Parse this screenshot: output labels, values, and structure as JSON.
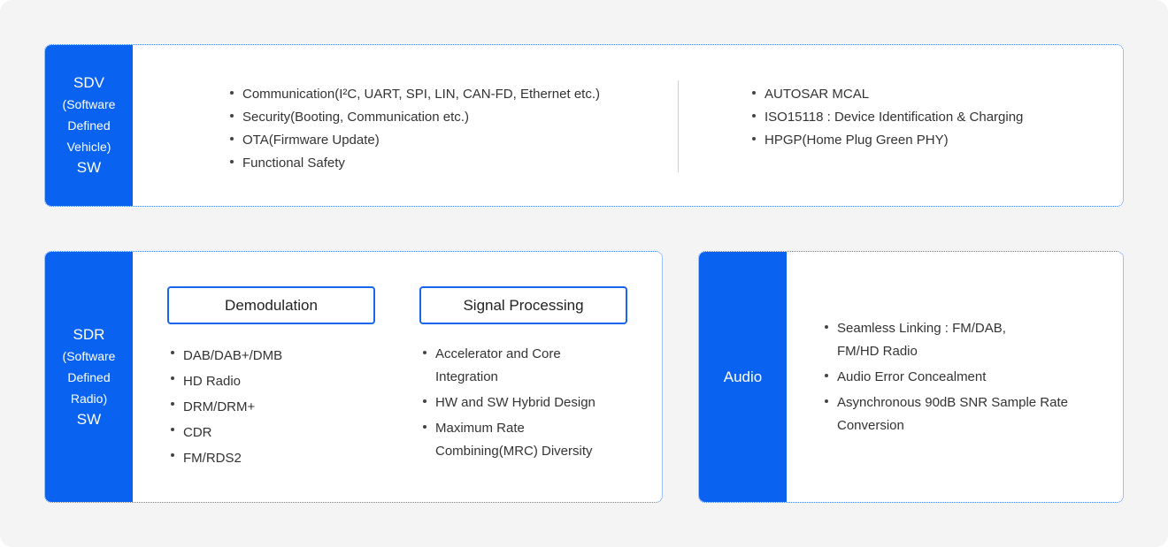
{
  "sdv": {
    "side": {
      "line1": "SDV",
      "line2": "(Software",
      "line3": "Defined",
      "line4": "Vehicle)",
      "line5": "SW"
    },
    "left_items": [
      "Communication(I²C, UART, SPI, LIN, CAN-FD, Ethernet etc.)",
      "Security(Booting, Communication etc.)",
      "OTA(Firmware Update)",
      "Functional Safety"
    ],
    "right_items": [
      "AUTOSAR MCAL",
      "ISO15118 : Device Identification & Charging",
      "HPGP(Home Plug Green PHY)"
    ]
  },
  "sdr": {
    "side": {
      "line1": "SDR",
      "line2": "(Software",
      "line3": "Defined",
      "line4": "Radio)",
      "line5": "SW"
    },
    "demodulation": {
      "title": "Demodulation",
      "items": [
        "DAB/DAB+/DMB",
        "HD Radio",
        "DRM/DRM+",
        "CDR",
        "FM/RDS2"
      ]
    },
    "signal_processing": {
      "title": "Signal Processing",
      "items": [
        "Accelerator and Core Integration",
        "HW and SW Hybrid Design",
        "Maximum Rate Combining(MRC) Diversity"
      ]
    }
  },
  "audio": {
    "side": {
      "label": "Audio"
    },
    "items": [
      "Seamless Linking : FM/DAB, FM/HD Radio",
      "Audio Error Concealment",
      "Asynchronous 90dB SNR Sample Rate Conversion"
    ]
  },
  "colors": {
    "accent": "#0a63f0",
    "background": "#f4f4f4",
    "border": "#3b7ff0",
    "text": "#333333"
  }
}
